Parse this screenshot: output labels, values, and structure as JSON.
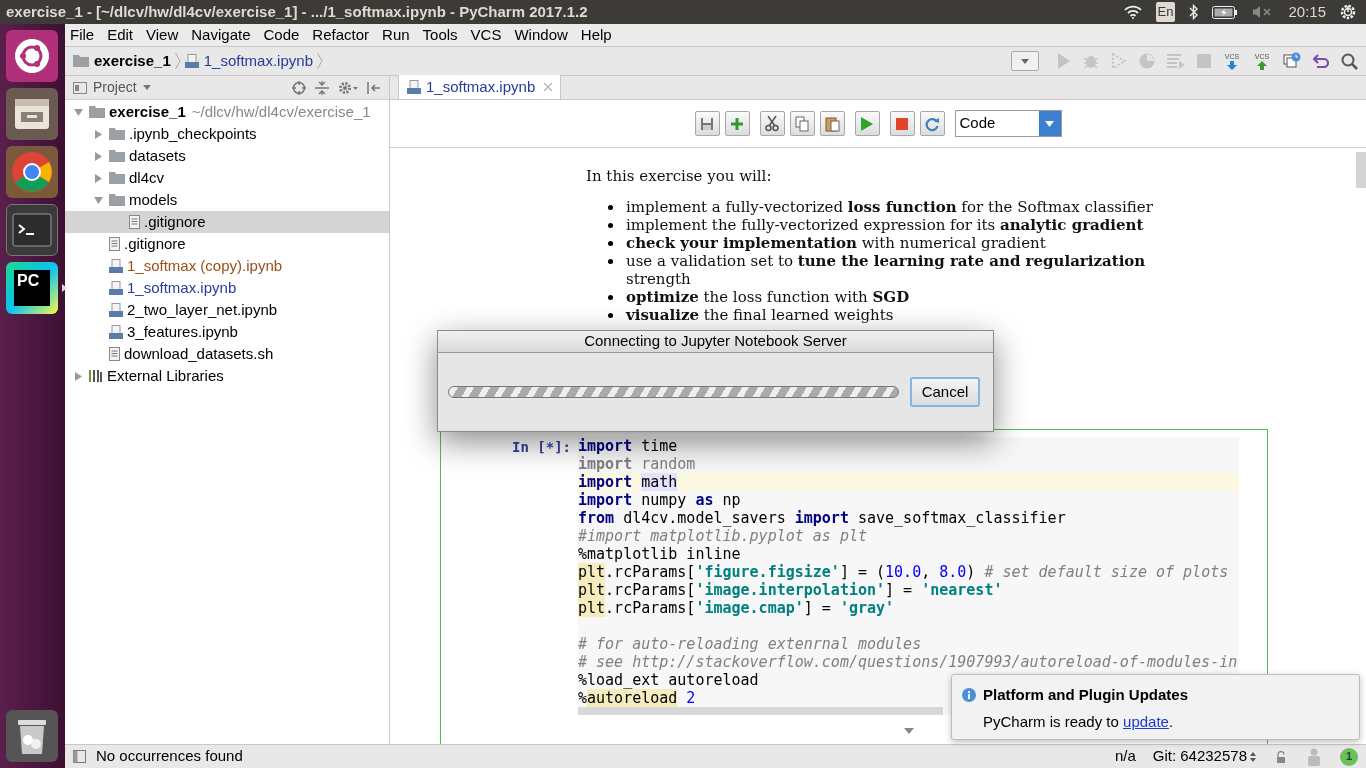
{
  "top_bar": {
    "title": "exercise_1 - [~/dlcv/hw/dl4cv/exercise_1] - .../1_softmax.ipynb - PyCharm 2017.1.2",
    "keyboard": "En",
    "clock": "20:15",
    "muted": true
  },
  "launcher": [
    {
      "kind": "ubuntu"
    },
    {
      "kind": "files"
    },
    {
      "kind": "chrome"
    },
    {
      "kind": "terminal"
    },
    {
      "kind": "pycharm",
      "label": "PC",
      "running": true
    },
    {
      "kind": "trash"
    }
  ],
  "menu": [
    {
      "label": "File"
    },
    {
      "label": "Edit"
    },
    {
      "label": "View"
    },
    {
      "label": "Navigate"
    },
    {
      "label": "Code"
    },
    {
      "label": "Refactor"
    },
    {
      "label": "Run"
    },
    {
      "label": "Tools"
    },
    {
      "label": "VCS"
    },
    {
      "label": "Window"
    },
    {
      "label": "Help"
    }
  ],
  "breadcrumb": [
    {
      "label": "exercise_1",
      "kind": "folder"
    },
    {
      "label": "1_softmax.ipynb",
      "kind": "notebook"
    }
  ],
  "toolbar": [
    {
      "kind": "config-dropdown",
      "disabled": false
    },
    {
      "kind": "run",
      "disabled": true
    },
    {
      "kind": "debug",
      "disabled": true
    },
    {
      "kind": "coverage",
      "disabled": true
    },
    {
      "kind": "profile",
      "disabled": true
    },
    {
      "kind": "concurrency",
      "disabled": true
    },
    {
      "kind": "stop",
      "disabled": true
    },
    {
      "kind": "vcs-update",
      "label": "VCS",
      "disabled": false
    },
    {
      "kind": "vcs-commit",
      "label": "VCS",
      "disabled": false
    },
    {
      "kind": "history",
      "disabled": false
    },
    {
      "kind": "revert",
      "disabled": false
    },
    {
      "kind": "search",
      "disabled": false
    }
  ],
  "project_panel": {
    "title": "Project",
    "tree": [
      {
        "label": "exercise_1",
        "path": "~/dlcv/hw/dl4cv/exercise_1",
        "kind": "folder",
        "expanded": true,
        "selected": false,
        "color": "#000000",
        "children": [
          {
            "label": ".ipynb_checkpoints",
            "kind": "folder",
            "expanded": false,
            "selected": false,
            "color": "#000000"
          },
          {
            "label": "datasets",
            "kind": "folder",
            "expanded": false,
            "selected": false,
            "color": "#000000"
          },
          {
            "label": "dl4cv",
            "kind": "folder",
            "expanded": false,
            "selected": false,
            "color": "#000000"
          },
          {
            "label": "models",
            "kind": "folder",
            "expanded": true,
            "selected": false,
            "color": "#000000",
            "children": [
              {
                "label": ".gitignore",
                "kind": "file",
                "selected": true,
                "color": "#000000"
              }
            ]
          },
          {
            "label": ".gitignore",
            "kind": "file",
            "selected": false,
            "color": "#000000"
          },
          {
            "label": "1_softmax (copy).ipynb",
            "kind": "notebook",
            "selected": false,
            "color": "#9c4f1a"
          },
          {
            "label": "1_softmax.ipynb",
            "kind": "notebook",
            "selected": false,
            "color": "#283c9a"
          },
          {
            "label": "2_two_layer_net.ipynb",
            "kind": "notebook",
            "selected": false,
            "color": "#000000"
          },
          {
            "label": "3_features.ipynb",
            "kind": "notebook",
            "selected": false,
            "color": "#000000"
          },
          {
            "label": "download_datasets.sh",
            "kind": "file",
            "selected": false,
            "color": "#000000"
          }
        ]
      },
      {
        "label": "External Libraries",
        "kind": "library",
        "expanded": false,
        "selected": false,
        "color": "#000000"
      }
    ]
  },
  "editor_tabs": [
    {
      "label": "1_softmax.ipynb",
      "selected": true
    }
  ],
  "notebook_toolbar": {
    "buttons": [
      {
        "kind": "save"
      },
      {
        "kind": "add"
      },
      {
        "kind": "cut"
      },
      {
        "kind": "copy"
      },
      {
        "kind": "paste"
      },
      {
        "kind": "run"
      },
      {
        "kind": "stop"
      },
      {
        "kind": "restart"
      }
    ],
    "cell_type": "Code"
  },
  "markdown": {
    "intro": "In this exercise you will:",
    "bullets": [
      "implement a fully-vectorized **loss function** for the Softmax classifier",
      "implement the fully-vectorized expression for its **analytic gradient**",
      "**check your implementation** with numerical gradient",
      "use a validation set to **tune the learning rate and regularization** strength",
      "**optimize** the loss function with **SGD**",
      "**visualize** the final learned weights"
    ]
  },
  "code_cell": {
    "prompt": "In [*]:",
    "lines": [
      {
        "kind": "code",
        "tokens": [
          {
            "text": "import",
            "kind": "kw"
          },
          {
            "text": " time",
            "kind": "plain"
          }
        ]
      },
      {
        "kind": "code",
        "tokens": [
          {
            "text": "import",
            "kind": "unused-kw"
          },
          {
            "text": " random",
            "kind": "unused"
          }
        ]
      },
      {
        "kind": "code",
        "current": true,
        "tokens": [
          {
            "text": "import ",
            "kind": "kw"
          },
          {
            "text": "math",
            "kind": "usage"
          }
        ]
      },
      {
        "kind": "code",
        "tokens": [
          {
            "text": "import",
            "kind": "kw"
          },
          {
            "text": " numpy ",
            "kind": "plain"
          },
          {
            "text": "as",
            "kind": "kw"
          },
          {
            "text": " np",
            "kind": "plain"
          }
        ]
      },
      {
        "kind": "code",
        "tokens": [
          {
            "text": "from",
            "kind": "kw"
          },
          {
            "text": " dl4cv.model_savers ",
            "kind": "plain"
          },
          {
            "text": "import",
            "kind": "kw"
          },
          {
            "text": " save_softmax_classifier",
            "kind": "plain"
          }
        ]
      },
      {
        "kind": "code",
        "tokens": [
          {
            "text": "#import matplotlib.pyplot as plt",
            "kind": "comment"
          }
        ]
      },
      {
        "kind": "code",
        "tokens": [
          {
            "text": "%matplotlib inline",
            "kind": "plain"
          }
        ]
      },
      {
        "kind": "code",
        "tokens": [
          {
            "text": "plt",
            "kind": "warn"
          },
          {
            "text": ".rcParams[",
            "kind": "plain"
          },
          {
            "text": "'figure.figsize'",
            "kind": "str"
          },
          {
            "text": "] = (",
            "kind": "plain"
          },
          {
            "text": "10.0",
            "kind": "num"
          },
          {
            "text": ", ",
            "kind": "plain"
          },
          {
            "text": "8.0",
            "kind": "num"
          },
          {
            "text": ") ",
            "kind": "plain"
          },
          {
            "text": "# set default size of plots",
            "kind": "comment"
          }
        ]
      },
      {
        "kind": "code",
        "tokens": [
          {
            "text": "plt",
            "kind": "warn"
          },
          {
            "text": ".rcParams[",
            "kind": "plain"
          },
          {
            "text": "'image.interpolation'",
            "kind": "str"
          },
          {
            "text": "] = ",
            "kind": "plain"
          },
          {
            "text": "'nearest'",
            "kind": "str"
          }
        ]
      },
      {
        "kind": "code",
        "tokens": [
          {
            "text": "plt",
            "kind": "warn"
          },
          {
            "text": ".rcParams[",
            "kind": "plain"
          },
          {
            "text": "'image.cmap'",
            "kind": "str"
          },
          {
            "text": "] = ",
            "kind": "plain"
          },
          {
            "text": "'gray'",
            "kind": "str"
          }
        ]
      },
      {
        "kind": "blank"
      },
      {
        "kind": "code",
        "tokens": [
          {
            "text": "# for auto-reloading extenrnal modules",
            "kind": "comment"
          }
        ]
      },
      {
        "kind": "code",
        "tokens": [
          {
            "text": "# see http://stackoverflow.com/questions/1907993/autoreload-of-modules-in",
            "kind": "comment"
          }
        ]
      },
      {
        "kind": "code",
        "tokens": [
          {
            "text": "%load_ext autoreload",
            "kind": "plain"
          }
        ]
      },
      {
        "kind": "code",
        "tokens": [
          {
            "text": "%",
            "kind": "plain"
          },
          {
            "text": "autoreload",
            "kind": "warn"
          },
          {
            "text": " 2",
            "kind": "num"
          }
        ]
      }
    ]
  },
  "dialog": {
    "title": "Connecting to Jupyter Notebook Server",
    "progress": {
      "indeterminate": true
    },
    "button": "Cancel"
  },
  "notification": {
    "title": "Platform and Plugin Updates",
    "text": "PyCharm is ready to ",
    "link": "update",
    "after": "."
  },
  "status_bar": {
    "message": "No occurrences found",
    "position": "n/a",
    "git": "Git: 64232578",
    "events": "1"
  }
}
